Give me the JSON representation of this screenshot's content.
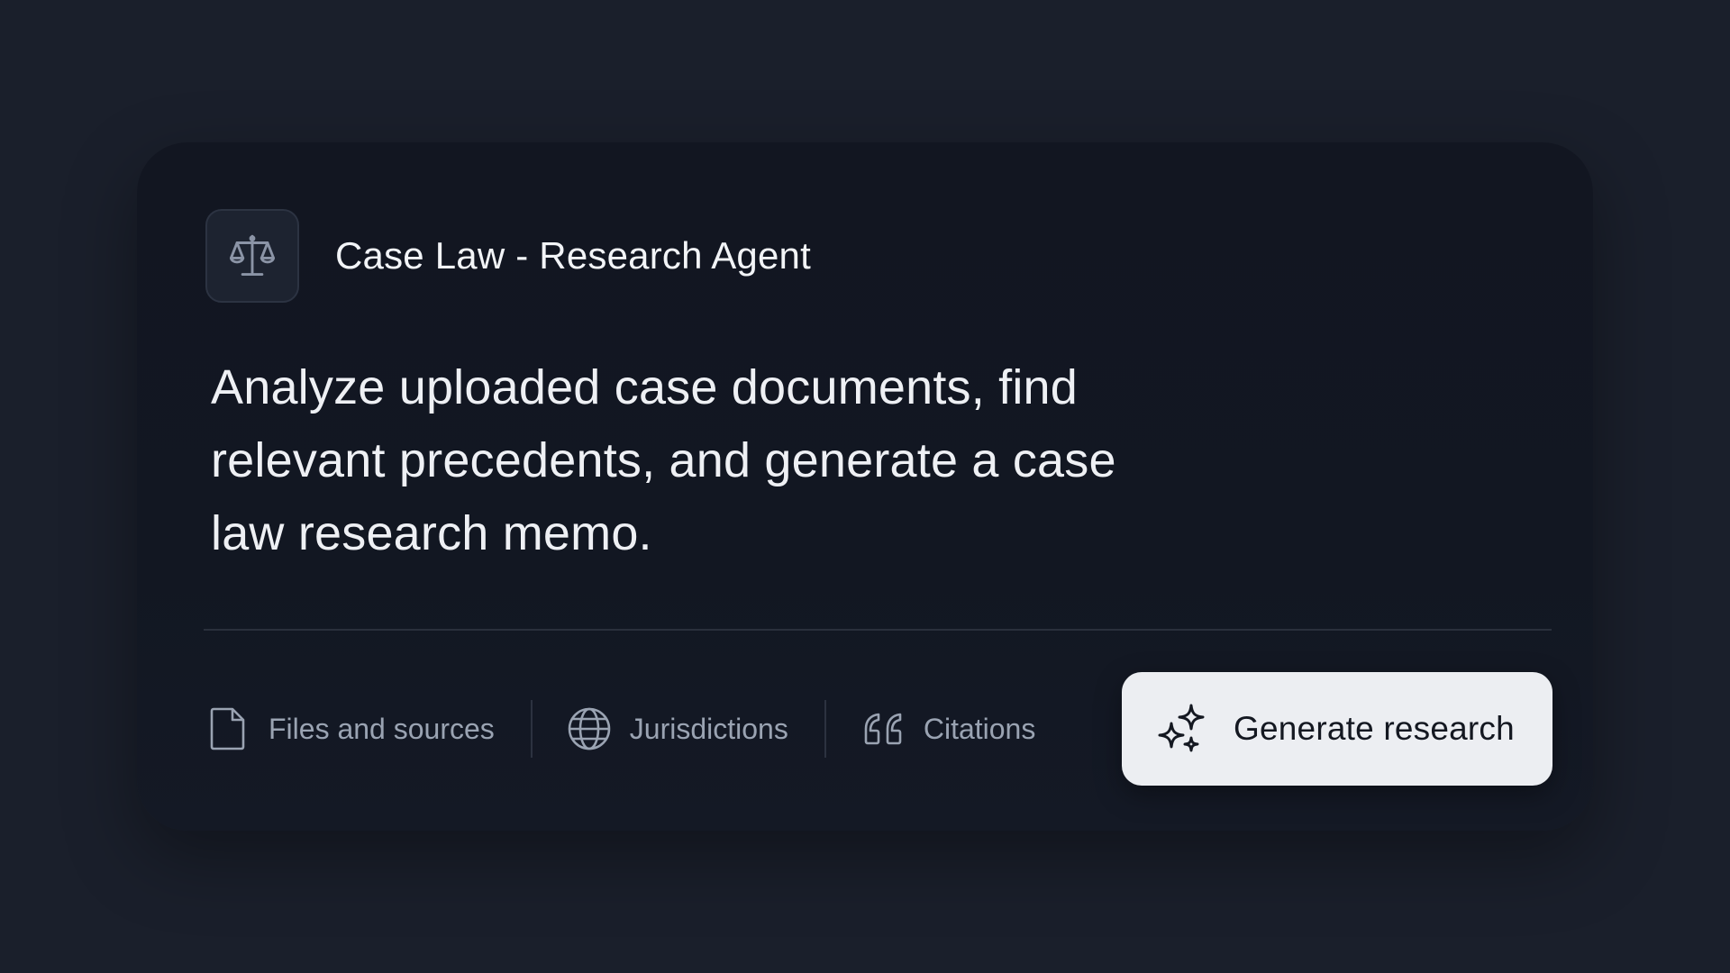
{
  "agent": {
    "title": "Case Law - Research Agent",
    "icon": "scales-of-justice-icon",
    "description": "Analyze uploaded case documents, find relevant precedents, and generate a case law research memo."
  },
  "toolbar": {
    "items": [
      {
        "label": "Files and sources",
        "icon": "file-icon"
      },
      {
        "label": "Jurisdictions",
        "icon": "globe-icon"
      },
      {
        "label": "Citations",
        "icon": "quote-icon"
      }
    ],
    "primary_action": {
      "label": "Generate research",
      "icon": "sparkles-icon"
    }
  },
  "colors": {
    "background": "#1a1f2b",
    "card": "#121621",
    "primary_button": "#eceef2",
    "muted_text": "#9aa3b2"
  }
}
